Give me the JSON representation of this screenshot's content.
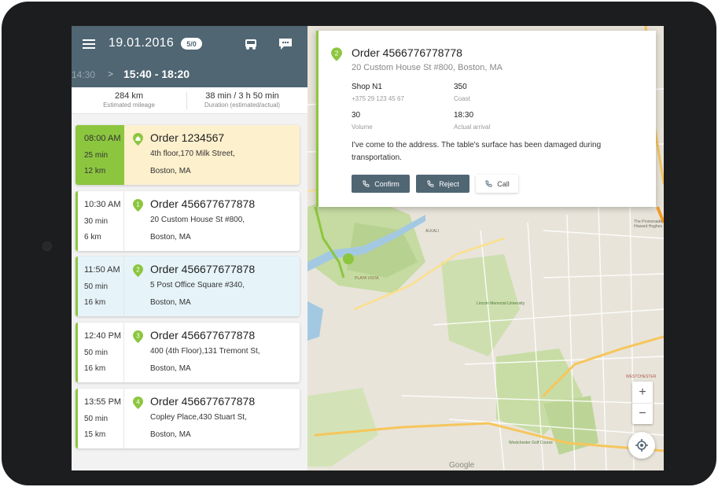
{
  "header": {
    "date": "19.01.2016",
    "badge": "5/0",
    "prev_time": "14:30",
    "arrow": ">",
    "time_range": "15:40 - 18:20"
  },
  "stats": {
    "mileage_value": "284 km",
    "mileage_label": "Estimated mileage",
    "duration_value": "38 min / 3 h 50 min",
    "duration_label": "Duration (estimated/actual)"
  },
  "orders": [
    {
      "time": "08:00 AM",
      "duration": "25 min",
      "distance": "12 km",
      "marker": "home",
      "title": "Order 1234567",
      "address1": "4th floor,170 Milk Street,",
      "address2": "Boston, MA",
      "state": "selected"
    },
    {
      "time": "10:30 AM",
      "duration": "30 min",
      "distance": "6 km",
      "marker": "1",
      "title": "Order 456677677878",
      "address1": "20 Custom House St #800,",
      "address2": "Boston, MA",
      "state": "normal"
    },
    {
      "time": "11:50 AM",
      "duration": "50 min",
      "distance": "16 km",
      "marker": "2",
      "title": "Order 456677677878",
      "address1": "5 Post Office Square #340,",
      "address2": "Boston, MA",
      "state": "current"
    },
    {
      "time": "12:40 PM",
      "duration": "50 min",
      "distance": "16 km",
      "marker": "3",
      "title": "Order 456677677878",
      "address1": "400 (4th Floor),131 Tremont St,",
      "address2": "Boston, MA",
      "state": "normal"
    },
    {
      "time": "13:55 PM",
      "duration": "50 min",
      "distance": "15 km",
      "marker": "4",
      "title": "Order 456677677878",
      "address1": "Copley Place,430 Stuart St,",
      "address2": "Boston, MA",
      "state": "normal"
    }
  ],
  "popup": {
    "marker": "2",
    "title": "Order 4566776778778",
    "address": "20 Custom House St #800, Boston, MA",
    "shop": "Shop N1",
    "phone": "+375 29 123 45 67",
    "cost_value": "350",
    "cost_label": "Coast",
    "volume_value": "30",
    "volume_label": "Volume",
    "arrival_value": "18:30",
    "arrival_label": "Actual arrival",
    "message": "I've come to the address.  The table's surface has been damaged during transportation.",
    "confirm_label": "Confirm",
    "reject_label": "Reject",
    "call_label": "Call"
  },
  "map": {
    "brand": "Google",
    "zoom_in": "+",
    "zoom_out": "−",
    "labels": [
      "Lincoln Memorial University",
      "Westchester Golf Course",
      "WESTCHESTER",
      "The Promenade Howard Hughes",
      "PLAYA VISTA",
      "ALKALI"
    ]
  },
  "colors": {
    "header_bg": "#506673",
    "accent_green": "#8cc63f",
    "selected_card_bg": "#fdf0cd",
    "current_card_bg": "#e6f4fa",
    "map_park": "#c5dba1",
    "map_water": "#a3c9e2"
  },
  "icons": [
    "menu-icon",
    "truck-icon",
    "message-icon",
    "home-marker-icon",
    "number-marker-icon",
    "phone-icon",
    "locate-icon"
  ]
}
